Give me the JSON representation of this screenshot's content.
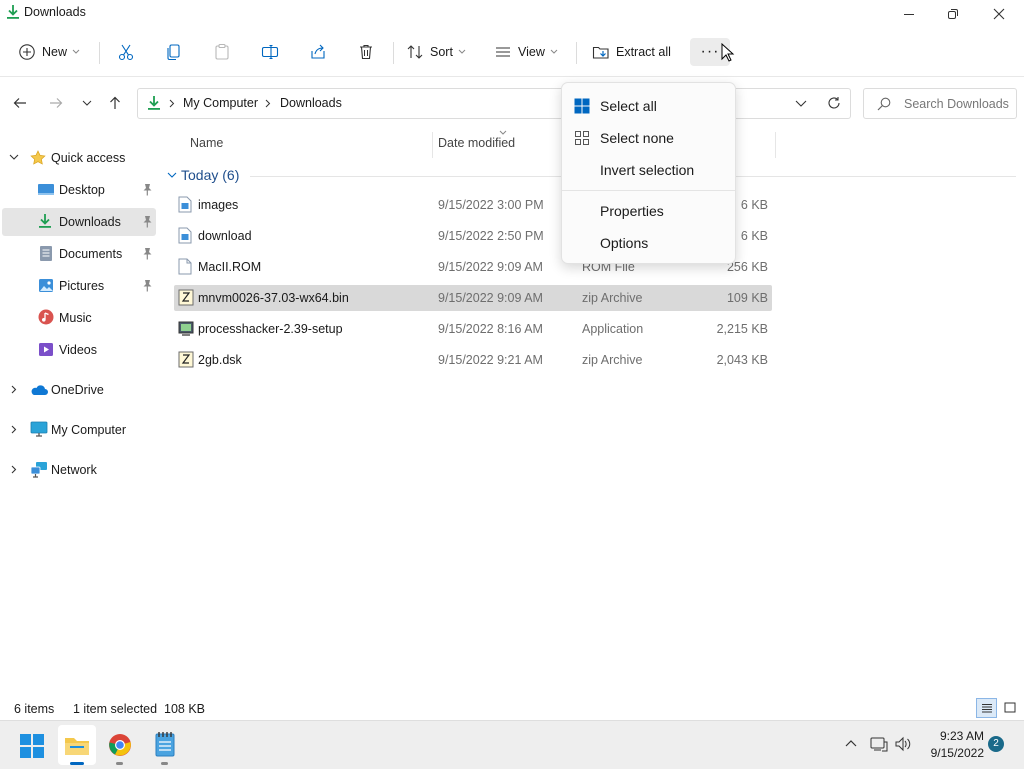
{
  "window": {
    "title": "Downloads"
  },
  "toolbar": {
    "new_label": "New",
    "sort_label": "Sort",
    "view_label": "View",
    "extract_label": "Extract all",
    "more_label": "···"
  },
  "address": {
    "crumbs": [
      "My Computer",
      "Downloads"
    ],
    "search_placeholder": "Search Downloads"
  },
  "nav": {
    "quick_access": "Quick access",
    "pinned": [
      {
        "label": "Desktop",
        "icon": "desktop-icon",
        "color": "#3b8fd9"
      },
      {
        "label": "Downloads",
        "icon": "download-icon",
        "color": "#1e9e52"
      },
      {
        "label": "Documents",
        "icon": "document-icon",
        "color": "#8a99ad"
      },
      {
        "label": "Pictures",
        "icon": "picture-icon",
        "color": "#3b8fd9"
      }
    ],
    "unpinned": [
      {
        "label": "Music",
        "icon": "music-icon",
        "color": "#d9534f"
      },
      {
        "label": "Videos",
        "icon": "video-icon",
        "color": "#7b4fc9"
      }
    ],
    "roots": [
      {
        "label": "OneDrive",
        "icon": "cloud-icon"
      },
      {
        "label": "My Computer",
        "icon": "computer-icon"
      },
      {
        "label": "Network",
        "icon": "network-icon"
      }
    ]
  },
  "columns": {
    "name": "Name",
    "date": "Date modified"
  },
  "group": {
    "label": "Today (6)"
  },
  "files": [
    {
      "name": "images",
      "date": "9/15/2022 3:00 PM",
      "type": "",
      "size": "6 KB",
      "icon": "image-file-icon"
    },
    {
      "name": "download",
      "date": "9/15/2022 2:50 PM",
      "type": "",
      "size": "6 KB",
      "icon": "image-file-icon"
    },
    {
      "name": "MacII.ROM",
      "date": "9/15/2022 9:09 AM",
      "type": "ROM File",
      "size": "256 KB",
      "icon": "blank-file-icon"
    },
    {
      "name": "mnvm0026-37.03-wx64.bin",
      "date": "9/15/2022 9:09 AM",
      "type": "zip Archive",
      "size": "109 KB",
      "icon": "zip-file-icon",
      "selected": true
    },
    {
      "name": "processhacker-2.39-setup",
      "date": "9/15/2022 8:16 AM",
      "type": "Application",
      "size": "2,215 KB",
      "icon": "app-file-icon"
    },
    {
      "name": "2gb.dsk",
      "date": "9/15/2022 9:21 AM",
      "type": "zip Archive",
      "size": "2,043 KB",
      "icon": "zip-file-icon"
    }
  ],
  "menu": {
    "select_all": "Select all",
    "select_none": "Select none",
    "invert": "Invert selection",
    "properties": "Properties",
    "options": "Options"
  },
  "status": {
    "items": "6 items",
    "selected": "1 item selected  108 KB"
  },
  "taskbar": {
    "time": "9:23 AM",
    "date": "9/15/2022",
    "badge": "2"
  },
  "colors": {
    "accent": "#0067c0",
    "selection": "#d9d9d9",
    "download_green": "#1e9e52",
    "folder_yellow": "#f4c84c"
  }
}
